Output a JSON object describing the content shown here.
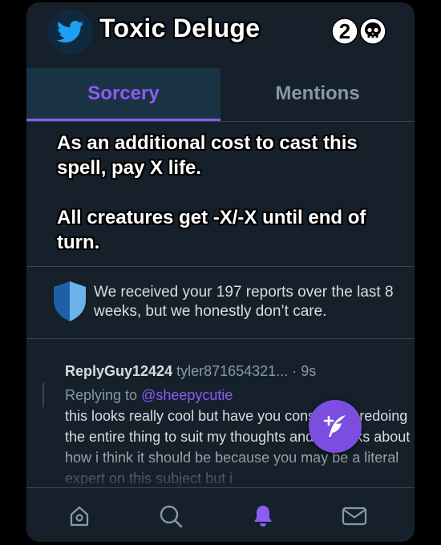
{
  "header": {
    "title": "Toxic Deluge",
    "logo_icon": "twitter-bird-icon",
    "mana_cost": {
      "generic": "2",
      "colored_icon": "skull-icon"
    }
  },
  "tabs": [
    {
      "label": "Sorcery",
      "active": true
    },
    {
      "label": "Mentions",
      "active": false
    }
  ],
  "rules_text": [
    "As an additional cost to cast this spell, pay X life.",
    "All creatures get -X/-X until end of turn."
  ],
  "notice": {
    "icon": "shield-icon",
    "text": "We received your 197 reports over the last 8 weeks, but we honestly don’t care."
  },
  "tweet": {
    "display_name": "ReplyGuy12424",
    "handle": "tyler871654321...",
    "separator": "·",
    "time": "9s",
    "replying_prefix": "Replying to",
    "replying_to": "@sheepycutie",
    "body": "this looks really cool but have you considered redoing the entire thing to suit my thoughts and remarks about how i think it should be because you may be a literal expert on this subject but i"
  },
  "fab": {
    "icon": "compose-feather-icon"
  },
  "bottom_nav": [
    {
      "icon": "home-icon",
      "active": false
    },
    {
      "icon": "search-icon",
      "active": false
    },
    {
      "icon": "bell-icon",
      "active": true
    },
    {
      "icon": "mail-icon",
      "active": false
    }
  ],
  "colors": {
    "accent": "#8a5cf5",
    "background": "#15202b",
    "divider": "#38444d",
    "muted_text": "#8899a6",
    "twitter_blue": "#1da1f2"
  }
}
